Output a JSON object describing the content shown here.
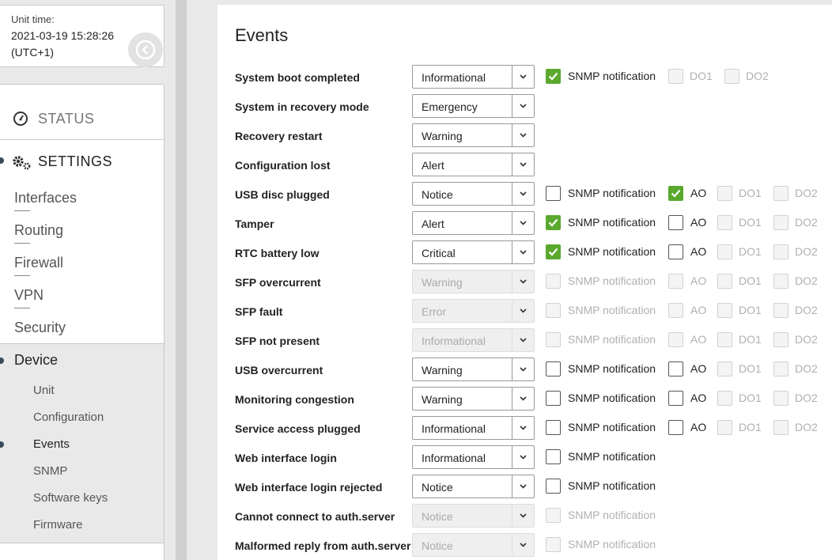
{
  "unit_time": {
    "label": "Unit time:",
    "date": "2021-03-19 15:28:26",
    "tz": "(UTC+1)"
  },
  "nav": {
    "status": "STATUS",
    "settings": "SETTINGS",
    "settings_items": [
      "Interfaces",
      "Routing",
      "Firewall",
      "VPN",
      "Security"
    ],
    "device": "Device",
    "device_items": [
      "Unit",
      "Configuration",
      "Events",
      "SNMP",
      "Software keys",
      "Firmware"
    ]
  },
  "page": {
    "title": "Events"
  },
  "labels": {
    "snmp": "SNMP notification",
    "ao": "AO",
    "do1": "DO1",
    "do2": "DO2"
  },
  "events": [
    {
      "name": "System boot completed",
      "severity": "Informational",
      "enabled": true,
      "snmp": true,
      "ao": null,
      "do1": false,
      "do2": false
    },
    {
      "name": "System in recovery mode",
      "severity": "Emergency",
      "enabled": true,
      "snmp": null
    },
    {
      "name": "Recovery restart",
      "severity": "Warning",
      "enabled": true,
      "snmp": null
    },
    {
      "name": "Configuration lost",
      "severity": "Alert",
      "enabled": true,
      "snmp": null
    },
    {
      "name": "USB disc plugged",
      "severity": "Notice",
      "enabled": true,
      "snmp": false,
      "ao": true,
      "do1": false,
      "do2": false
    },
    {
      "name": "Tamper",
      "severity": "Alert",
      "enabled": true,
      "snmp": true,
      "ao": false,
      "do1": false,
      "do2": false
    },
    {
      "name": "RTC battery low",
      "severity": "Critical",
      "enabled": true,
      "snmp": true,
      "ao": false,
      "do1": false,
      "do2": false
    },
    {
      "name": "SFP overcurrent",
      "severity": "Warning",
      "enabled": false,
      "snmp": false,
      "ao": false,
      "do1": false,
      "do2": false
    },
    {
      "name": "SFP fault",
      "severity": "Error",
      "enabled": false,
      "snmp": false,
      "ao": false,
      "do1": false,
      "do2": false
    },
    {
      "name": "SFP not present",
      "severity": "Informational",
      "enabled": false,
      "snmp": false,
      "ao": false,
      "do1": false,
      "do2": false
    },
    {
      "name": "USB overcurrent",
      "severity": "Warning",
      "enabled": true,
      "snmp": false,
      "ao": false,
      "do1": false,
      "do2": false
    },
    {
      "name": "Monitoring congestion",
      "severity": "Warning",
      "enabled": true,
      "snmp": false,
      "ao": false,
      "do1": false,
      "do2": false
    },
    {
      "name": "Service access plugged",
      "severity": "Informational",
      "enabled": true,
      "snmp": false,
      "ao": false,
      "do1": false,
      "do2": false
    },
    {
      "name": "Web interface login",
      "severity": "Informational",
      "enabled": true,
      "snmp": false
    },
    {
      "name": "Web interface login rejected",
      "severity": "Notice",
      "enabled": true,
      "snmp": false
    },
    {
      "name": "Cannot connect to auth.server",
      "severity": "Notice",
      "enabled": false,
      "snmp": false
    },
    {
      "name": "Malformed reply from auth.server",
      "severity": "Notice",
      "enabled": false,
      "snmp": false
    }
  ],
  "colors": {
    "check_green": "#5aa82d",
    "nav_dot": "#3b4a5a"
  }
}
